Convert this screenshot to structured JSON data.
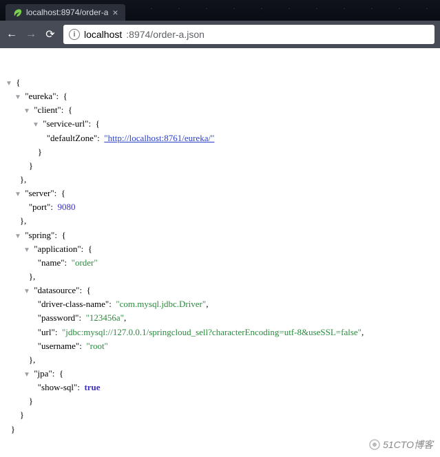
{
  "tab": {
    "title": "localhost:8974/order-a"
  },
  "address": {
    "host": "localhost",
    "port_path": ":8974/order-a.json"
  },
  "json": {
    "eureka_key": "\"eureka\"",
    "client_key": "\"client\"",
    "serviceurl_key": "\"service-url\"",
    "defaultZone_key": "\"defaultZone\"",
    "defaultZone_val": "\"http://localhost:8761/eureka/\"",
    "server_key": "\"server\"",
    "port_key": "\"port\"",
    "port_val": "9080",
    "spring_key": "\"spring\"",
    "application_key": "\"application\"",
    "name_key": "\"name\"",
    "name_val": "\"order\"",
    "datasource_key": "\"datasource\"",
    "dcn_key": "\"driver-class-name\"",
    "dcn_val": "\"com.mysql.jdbc.Driver\"",
    "password_key": "\"password\"",
    "password_val": "\"123456a\"",
    "url_key": "\"url\"",
    "url_val": "\"jdbc:mysql://127.0.0.1/springcloud_sell?characterEncoding=utf-8&useSSL=false\"",
    "username_key": "\"username\"",
    "username_val": "\"root\"",
    "jpa_key": "\"jpa\"",
    "showsql_key": "\"show-sql\"",
    "showsql_val": "true"
  },
  "watermark": "51CTO博客"
}
